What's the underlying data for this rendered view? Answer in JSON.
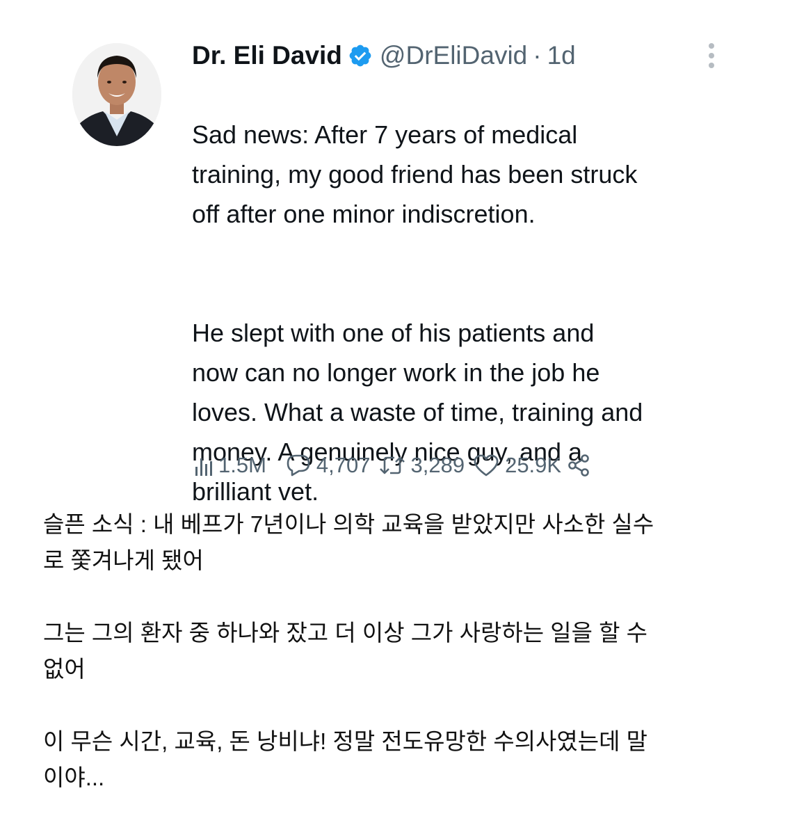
{
  "tweet": {
    "author": {
      "display_name": "Dr. Eli David",
      "handle": "@DrEliDavid",
      "verified": true,
      "verified_icon": "verified-badge-icon"
    },
    "separator": "·",
    "time": "1d",
    "more_icon": "more-dots-icon",
    "text_paragraph_1": "Sad news: After 7 years of medical\ntraining, my good friend has been struck\noff after one minor indiscretion.",
    "text_paragraph_2": "He slept with one of his patients and\nnow can no longer work in the job he\nloves. What a waste of time, training and\nmoney. A genuinely nice guy, and a\nbrilliant vet.",
    "stats": {
      "views": "1.5M",
      "replies": "4,707",
      "retweets": "3,289",
      "likes": "25.9K"
    },
    "icons": {
      "views": "bar-chart-icon",
      "replies": "reply-bubble-icon",
      "retweets": "retweet-icon",
      "likes": "heart-icon",
      "share": "share-icon"
    },
    "colors": {
      "text": "#0f1419",
      "secondary": "#536471",
      "verified": "#1d9bf0"
    }
  },
  "translation": {
    "paragraph_1": "슬픈 소식 : 내 베프가 7년이나 의학 교육을 받았지만 사소한 실수\n로 쫓겨나게 됐어",
    "paragraph_2": "그는 그의 환자 중 하나와 잤고 더 이상 그가 사랑하는 일을 할 수\n없어",
    "paragraph_3": "이 무슨 시간, 교육, 돈 낭비냐! 정말 전도유망한 수의사였는데 말\n이야..."
  }
}
